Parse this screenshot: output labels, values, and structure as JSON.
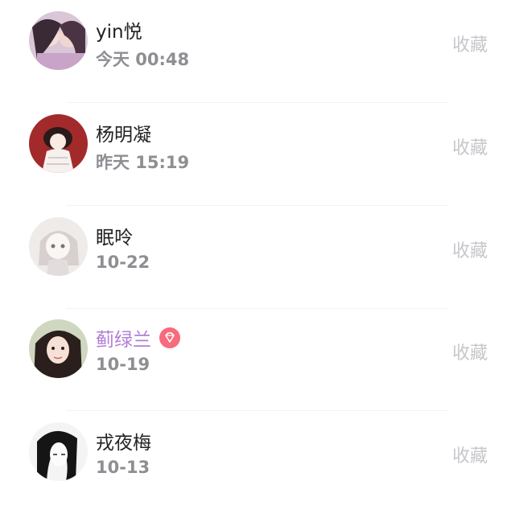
{
  "items": [
    {
      "name": "yin悦",
      "time": "今天 00:48",
      "action": "收藏",
      "vip": false
    },
    {
      "name": "杨明凝",
      "time": "昨天 15:19",
      "action": "收藏",
      "vip": false
    },
    {
      "name": "眠呤",
      "time": "10-22",
      "action": "收藏",
      "vip": false
    },
    {
      "name": "蓟绿兰",
      "time": "10-19",
      "action": "收藏",
      "vip": true
    },
    {
      "name": "戎夜梅",
      "time": "10-13",
      "action": "收藏",
      "vip": false
    }
  ],
  "colors": {
    "vip_name": "#b07ed8",
    "vip_badge": "#f76b7c",
    "action_text": "#c7c7cc",
    "time_text": "#8e8e93"
  },
  "icons": {
    "vip_badge": "diamond-icon"
  }
}
